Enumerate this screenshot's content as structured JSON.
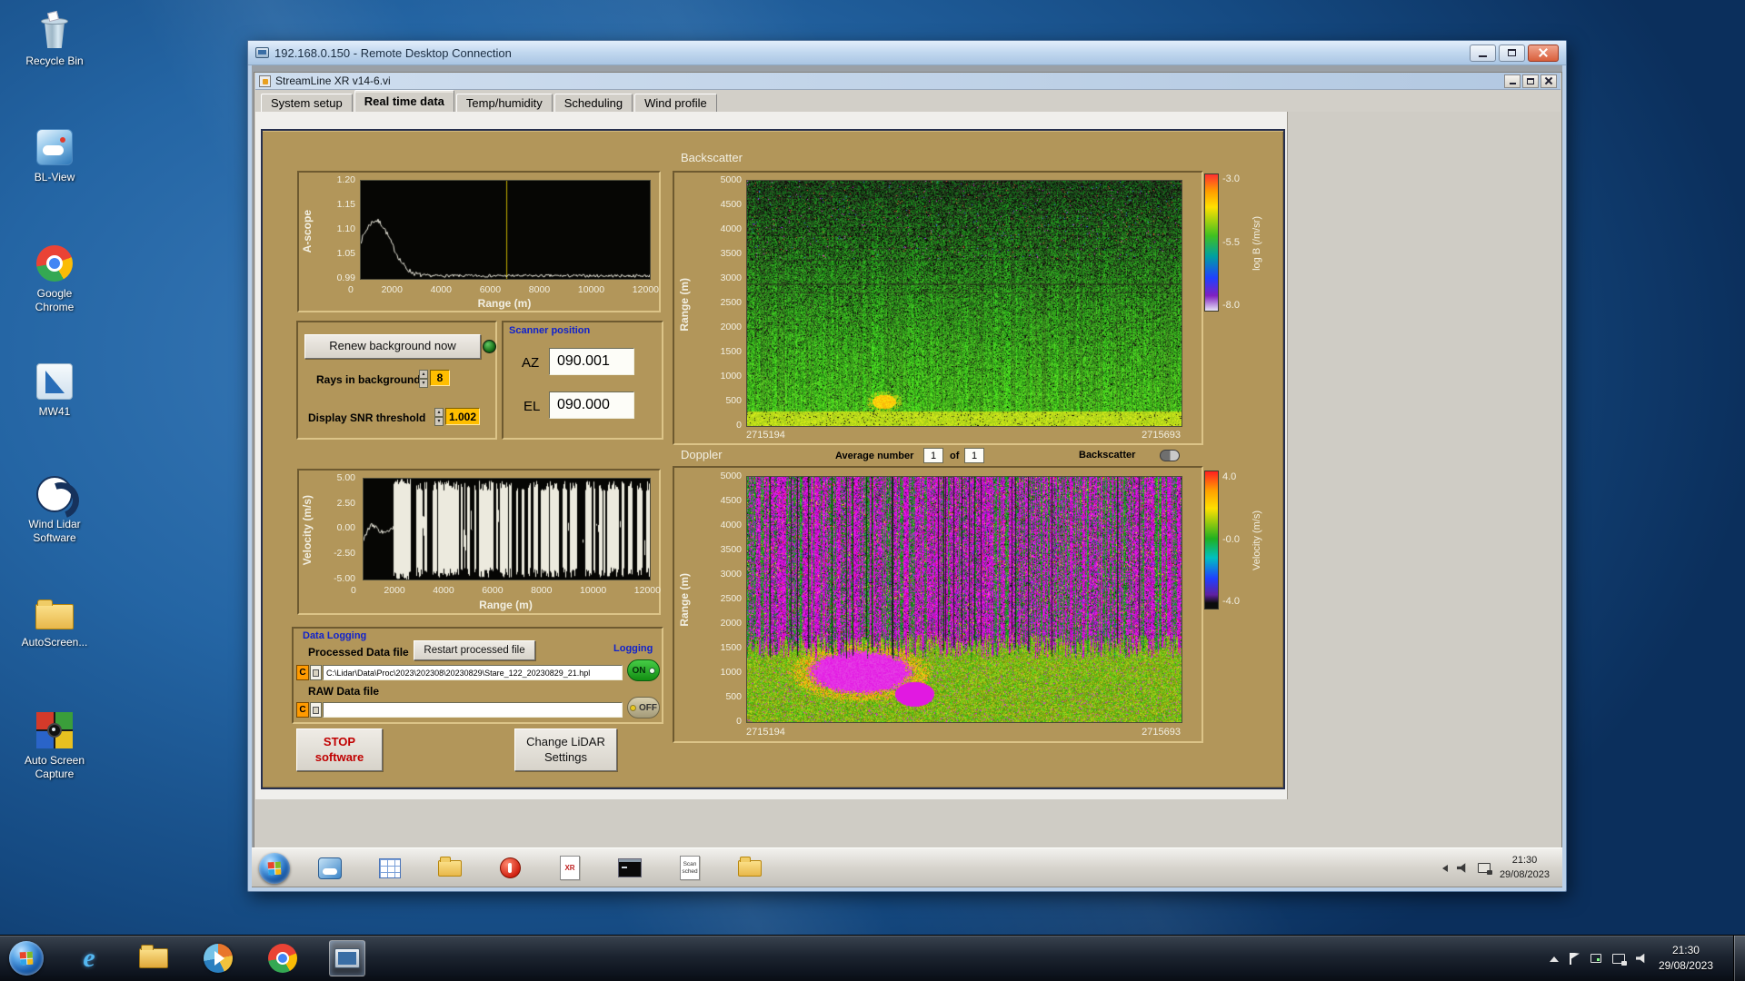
{
  "desktop": {
    "icons": [
      {
        "label": "Recycle Bin"
      },
      {
        "label": "BL-View"
      },
      {
        "label": "Google Chrome"
      },
      {
        "label": "MW41"
      },
      {
        "label": "Wind Lidar Software"
      },
      {
        "label": "AutoScreen..."
      },
      {
        "label": "Auto Screen Capture"
      }
    ]
  },
  "host_taskbar": {
    "time": "21:30",
    "date": "29/08/2023"
  },
  "rdp": {
    "title": "192.168.0.150 - Remote Desktop Connection",
    "remote_taskbar": {
      "time": "21:30",
      "date": "29/08/2023",
      "xr_doc_label": "XR",
      "scan_doc_line1": "Scan",
      "scan_doc_line2": "sched"
    },
    "app": {
      "title": "StreamLine XR v14-6.vi",
      "tabs": [
        {
          "label": "System setup"
        },
        {
          "label": "Real time data"
        },
        {
          "label": "Temp/humidity"
        },
        {
          "label": "Scheduling"
        },
        {
          "label": "Wind profile"
        }
      ],
      "panel": {
        "backscatter_title": "Backscatter",
        "doppler_title": "Doppler",
        "average_label": "Average number",
        "average_value": "1",
        "of_label": "of",
        "average_total": "1",
        "backscatter_switch_label": "Backscatter",
        "ascope": {
          "ylabel": "A-scope",
          "xlabel": "Range (m)",
          "yticks": [
            "1.20",
            "1.15",
            "1.10",
            "1.05",
            "0.99"
          ],
          "xticks": [
            "0",
            "2000",
            "4000",
            "6000",
            "8000",
            "10000",
            "12000"
          ]
        },
        "background_ctrl": {
          "renew_button": "Renew background now",
          "rays_label": "Rays in background",
          "rays_value": "8",
          "snr_label": "Display SNR threshold",
          "snr_value": "1.002"
        },
        "scanner": {
          "title": "Scanner position",
          "az_label": "AZ",
          "az_value": "090.001",
          "el_label": "EL",
          "el_value": "090.000"
        },
        "backscatter_plot": {
          "ylabel": "Range (m)",
          "yticks": [
            "5000",
            "4500",
            "4000",
            "3500",
            "3000",
            "2500",
            "2000",
            "1500",
            "1000",
            "500",
            "0"
          ],
          "t_start": "2715194",
          "t_end": "2715693",
          "colorbar_label": "log B (/m/sr)",
          "colorbar_ticks": [
            "-3.0",
            "-5.5",
            "-8.0"
          ]
        },
        "velocity_plot": {
          "ylabel": "Velocity (m/s)",
          "xlabel": "Range (m)",
          "yticks": [
            "5.00",
            "2.50",
            "0.00",
            "-2.50",
            "-5.00"
          ],
          "xticks": [
            "0",
            "2000",
            "4000",
            "6000",
            "8000",
            "10000",
            "12000"
          ]
        },
        "doppler_plot": {
          "ylabel": "Range (m)",
          "yticks": [
            "5000",
            "4500",
            "4000",
            "3500",
            "3000",
            "2500",
            "2000",
            "1500",
            "1000",
            "500",
            "0"
          ],
          "t_start": "2715194",
          "t_end": "2715693",
          "colorbar_label": "Velocity (m/s)",
          "colorbar_ticks": [
            "4.0",
            "-0.0",
            "-4.0"
          ]
        },
        "logging": {
          "group_title": "Data Logging",
          "processed_label": "Processed Data file",
          "restart_button": "Restart processed file",
          "logging_label": "Logging",
          "drive": "C",
          "processed_path": "C:\\Lidar\\Data\\Proc\\2023\\202308\\20230829\\Stare_122_20230829_21.hpl",
          "raw_label": "RAW Data file",
          "raw_path": "",
          "on_label": "ON",
          "off_label": "OFF"
        },
        "stop_button": {
          "line1": "STOP",
          "line2": "software"
        },
        "settings_button": {
          "line1": "Change LiDAR",
          "line2": "Settings"
        }
      }
    }
  }
}
